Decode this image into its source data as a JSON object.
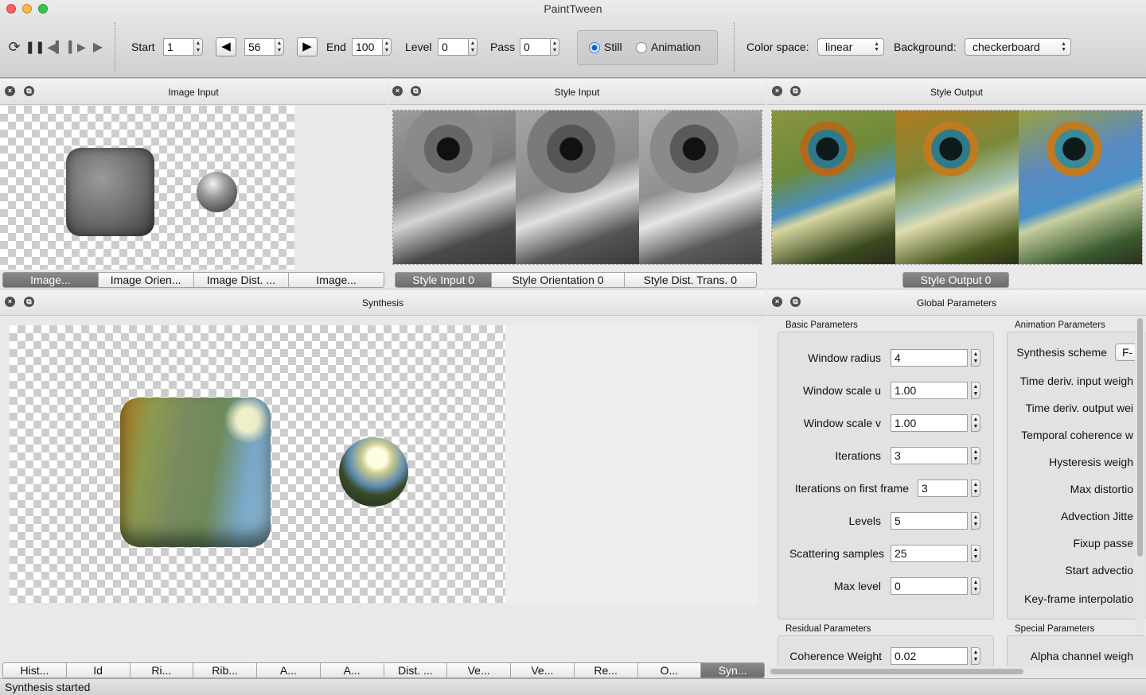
{
  "window": {
    "title": "PaintTween"
  },
  "toolbar": {
    "start_label": "Start",
    "start_value": "1",
    "frame_value": "56",
    "end_label": "End",
    "end_value": "100",
    "level_label": "Level",
    "level_value": "0",
    "pass_label": "Pass",
    "pass_value": "0",
    "still_label": "Still",
    "animation_label": "Animation",
    "mode_selected": "Still",
    "color_space_label": "Color space:",
    "color_space_value": "linear",
    "background_label": "Background:",
    "background_value": "checkerboard"
  },
  "image_input": {
    "title": "Image Input",
    "tabs": [
      "Image...",
      "Image Orien...",
      "Image Dist. ...",
      "Image..."
    ],
    "selected_tab": 0
  },
  "style_input": {
    "title": "Style Input",
    "tabs": [
      "Style Input 0",
      "Style Orientation 0",
      "Style Dist. Trans. 0"
    ],
    "selected_tab": 0
  },
  "style_output": {
    "title": "Style Output",
    "tabs": [
      "Style Output 0"
    ],
    "selected_tab": 0
  },
  "synthesis": {
    "title": "Synthesis",
    "tabs": [
      "Hist...",
      "Id",
      "Ri...",
      "Rib...",
      "A...",
      "A...",
      "Dist. ...",
      "Ve...",
      "Ve...",
      "Re...",
      "O...",
      "Syn..."
    ],
    "selected_tab": 11
  },
  "global_parameters": {
    "title": "Global Parameters",
    "basic_title": "Basic Parameters",
    "basic": [
      {
        "label": "Window radius",
        "value": "4"
      },
      {
        "label": "Window scale u",
        "value": "1.00"
      },
      {
        "label": "Window scale v",
        "value": "1.00"
      },
      {
        "label": "Iterations",
        "value": "3"
      },
      {
        "label": "Iterations on first frame",
        "value": "3"
      },
      {
        "label": "Levels",
        "value": "5"
      },
      {
        "label": "Scattering samples",
        "value": "25"
      },
      {
        "label": "Max level",
        "value": "0"
      }
    ],
    "animation_title": "Animation Parameters",
    "synthesis_scheme_label": "Synthesis scheme",
    "synthesis_scheme_value": "F-",
    "animation": [
      "Time deriv. input weigh",
      "Time deriv. output wei",
      "Temporal coherence w",
      "Hysteresis weigh",
      "Max distortio",
      "Advection Jitte",
      "Fixup passe",
      "Start advectio",
      "Key-frame interpolatio"
    ],
    "residual_title": "Residual Parameters",
    "coherence_label": "Coherence Weight",
    "coherence_value": "0.02",
    "special_title": "Special Parameters",
    "alpha_label": "Alpha channel weigh"
  },
  "status": {
    "text": "Synthesis started"
  },
  "icons": [
    "refresh-icon",
    "pause-icon",
    "step-back-icon",
    "step-forward-icon",
    "play-icon",
    "close-icon",
    "float-icon"
  ]
}
